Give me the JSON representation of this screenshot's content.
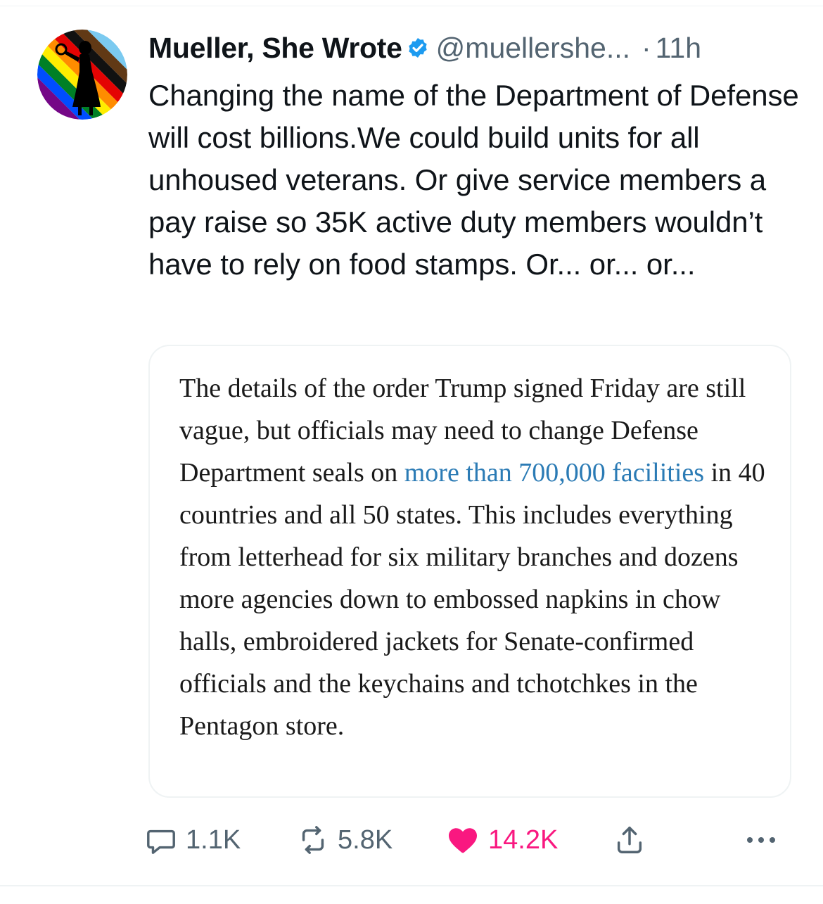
{
  "tweet": {
    "author_name": "Mueller, She Wrote",
    "handle": "@muellershe...",
    "separator": "·",
    "time": "11h",
    "text": "Changing the name of the Department of Defense will cost billions.We could build units for all unhoused veterans. Or give service members a pay raise so 35K active duty members wouldn’t have to rely on food stamps. Or... or... or..."
  },
  "quote": {
    "text_before": "The details of the order Trump signed Friday are still vague, but officials may need to change Defense Department seals on ",
    "link_text": "more than 700,000 facilities",
    "text_after": " in 40 countries and all 50 states. This includes everything from letterhead for six military branches and dozens more agencies down to embossed napkins in chow halls, embroidered jackets for Senate-confirmed officials and the keychains and tchotchkes in the Pentagon store."
  },
  "actions": {
    "reply_count": "1.1K",
    "retweet_count": "5.8K",
    "like_count": "14.2K"
  },
  "icons": {
    "verified": "verified-badge-icon",
    "reply": "reply-bubble-icon",
    "retweet": "retweet-icon",
    "like": "heart-filled-icon",
    "share": "share-upload-icon",
    "more": "more-dots-icon"
  },
  "colors": {
    "verified_blue": "#1d9bf0",
    "like_pink": "#f91880",
    "link_blue": "#2b7bb5",
    "secondary_text": "#536471"
  }
}
